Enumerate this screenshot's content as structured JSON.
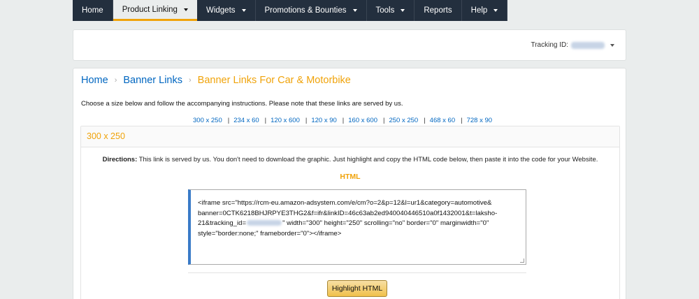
{
  "nav": {
    "items": [
      {
        "label": "Home",
        "dropdown": false,
        "active": false
      },
      {
        "label": "Product Linking",
        "dropdown": true,
        "active": true
      },
      {
        "label": "Widgets",
        "dropdown": true,
        "active": false
      },
      {
        "label": "Promotions & Bounties",
        "dropdown": true,
        "active": false
      },
      {
        "label": "Tools",
        "dropdown": true,
        "active": false
      },
      {
        "label": "Reports",
        "dropdown": false,
        "active": false
      },
      {
        "label": "Help",
        "dropdown": true,
        "active": false
      }
    ]
  },
  "tracking": {
    "label": "Tracking ID:"
  },
  "breadcrumb": {
    "home": "Home",
    "banner_links": "Banner Links",
    "current": "Banner Links For Car & Motorbike"
  },
  "intro_text": "Choose a size below and follow the accompanying instructions. Please note that these links are served by us.",
  "sizes": [
    "300 x 250",
    "234 x 60",
    "120 x 600",
    "120 x 90",
    "160 x 600",
    "250 x 250",
    "468 x 60",
    "728 x 90"
  ],
  "panel": {
    "title": "300 x 250",
    "directions_label": "Directions:",
    "directions_text": "This link is served by us. You don't need to download the graphic. Just highlight and copy the HTML code below, then paste it into the code for your Website.",
    "html_title": "HTML",
    "code_line1": "<iframe src=\"https://rcm-eu.amazon-adsystem.com/e/cm?o=2&p=12&l=ur1&category=automotive&",
    "code_line2": "banner=0CTK6218BHJRPYE3THG2&f=ifr&linkID=46c63ab2ed940040446510a0f1432001&t=laksho-",
    "code_line3a": "21&tracking_id=",
    "code_line3b": "\" width=\"300\" height=\"250\" scrolling=\"no\" border=\"0\" marginwidth=\"0\"",
    "code_line4": "style=\"border:none;\" frameborder=\"0\"></iframe>",
    "button": "Highlight HTML"
  },
  "colors": {
    "nav_bg": "#232f3e",
    "accent": "#f0a30a",
    "link": "#0066c0",
    "button": "#f0c14b"
  }
}
